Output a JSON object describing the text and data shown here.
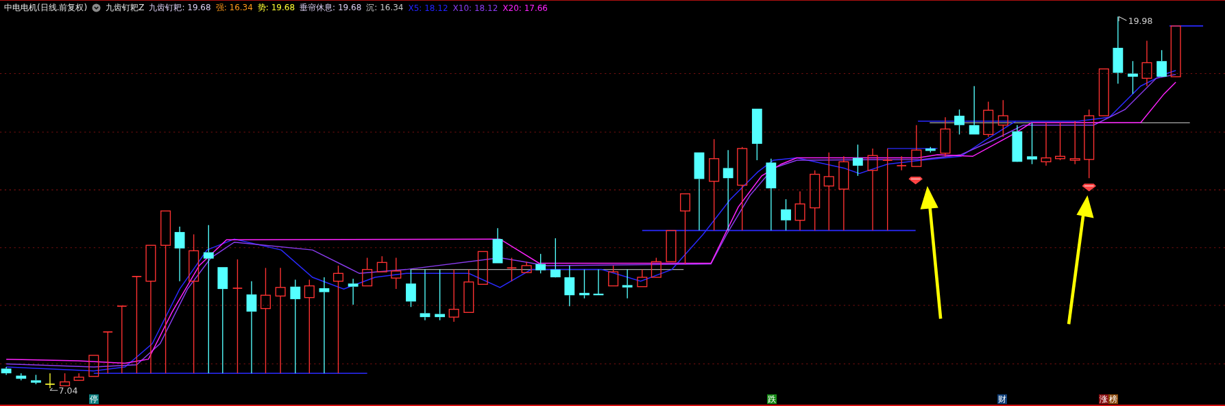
{
  "header": {
    "title": "中电电机(日线.前复权)",
    "indicator": "九齿钉耙Z",
    "values": [
      {
        "text": "九齿钉耙: 19.68",
        "color": "#dcd0f4"
      },
      {
        "text": "强: 16.34",
        "color": "#ff9a1a"
      },
      {
        "text": "势: 19.68",
        "color": "#ffff33"
      },
      {
        "text": "垂帘休息: 19.68",
        "color": "#dcd0f4"
      },
      {
        "text": "沉: 16.34",
        "color": "#c8c8c8"
      },
      {
        "text": "X5: 18.12",
        "color": "#2222ff"
      },
      {
        "text": "X10: 18.12",
        "color": "#8a3cf0"
      },
      {
        "text": "X20: 17.66",
        "color": "#ff22ff"
      }
    ]
  },
  "chart": {
    "high_label": "19.98",
    "low_label": "7.04"
  },
  "bottom_tags": [
    {
      "text": "停",
      "color": "#0d7f80"
    },
    {
      "text": "跌",
      "color": "#178a17"
    },
    {
      "text": "财",
      "color": "#0f3f78"
    },
    {
      "text": "涨",
      "color": "#8a0f12"
    },
    {
      "text": "榜",
      "color": "#8c4a0c"
    }
  ]
}
